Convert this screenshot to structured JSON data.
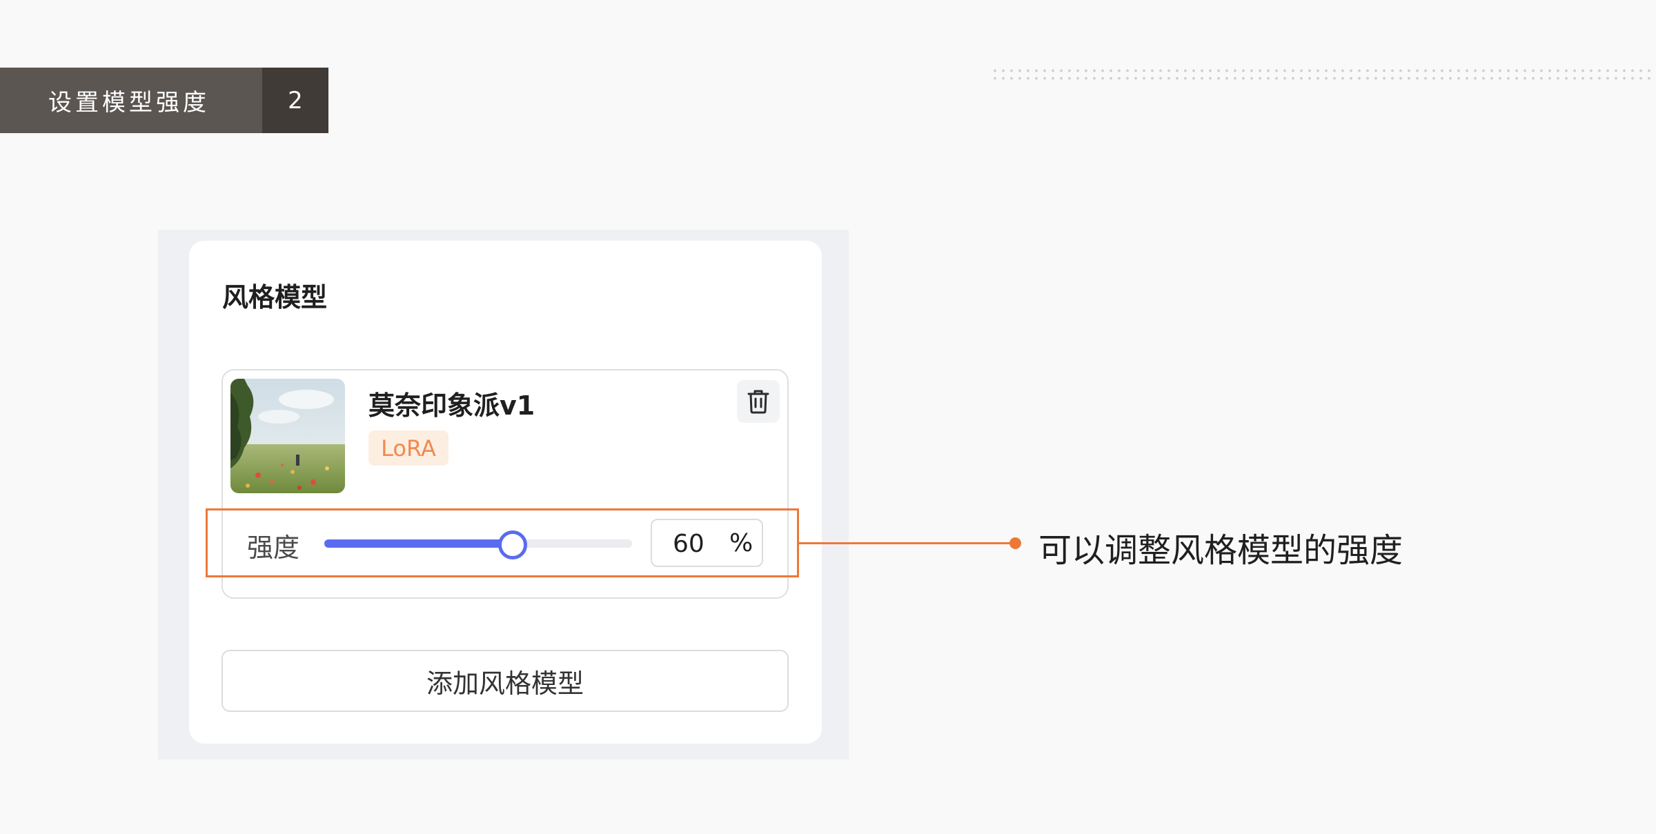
{
  "step": {
    "title": "设置模型强度",
    "number": "2"
  },
  "panel": {
    "title": "风格模型",
    "model": {
      "name": "莫奈印象派v1",
      "tag": "LoRA"
    },
    "strength": {
      "label": "强度",
      "value": "60",
      "unit": "%",
      "level_fraction": 0.6
    },
    "add_button_label": "添加风格模型"
  },
  "callout": {
    "text": "可以调整风格模型的强度"
  },
  "colors": {
    "accent": "#5b6bef",
    "highlight": "#ec7837",
    "tag_bg": "#fdeee2",
    "tag_text": "#f08a4e",
    "header_dark": "#403b37",
    "header_mid": "#5b5652"
  },
  "icons": {
    "delete": "trash-icon",
    "thumbnail": "monet-poppy-field-thumbnail"
  }
}
